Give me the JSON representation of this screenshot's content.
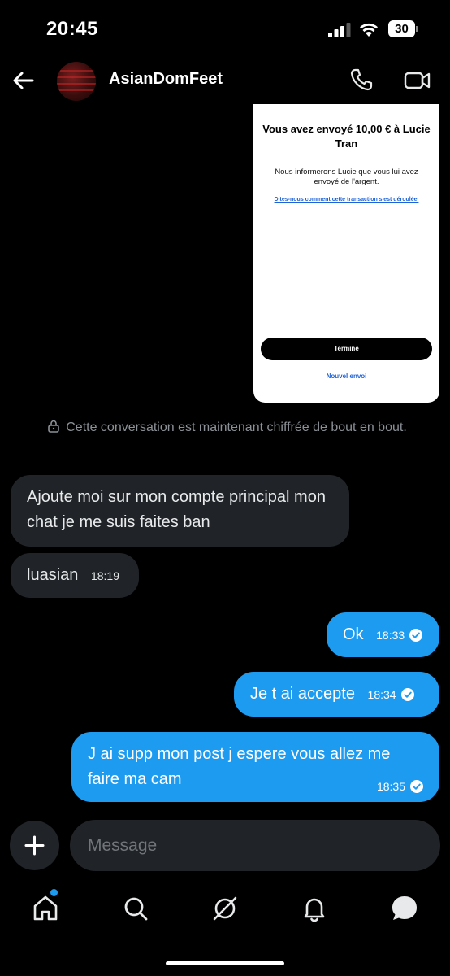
{
  "status_bar": {
    "time": "20:45",
    "battery": "30"
  },
  "header": {
    "contact_name": "AsianDomFeet"
  },
  "shared_image": {
    "title": "Vous avez envoyé 10,00 € à Lucie Tran",
    "description": "Nous informerons Lucie que vous lui avez envoyé de l'argent.",
    "feedback_link": "Dites-nous comment cette transaction s'est déroulée.",
    "done_button": "Terminé",
    "new_send_link": "Nouvel envoi"
  },
  "encryption_notice": "Cette conversation est maintenant chiffrée de bout en bout.",
  "messages": [
    {
      "direction": "in",
      "text": "Ajoute moi sur mon compte principal mon chat je me suis faites ban",
      "time": ""
    },
    {
      "direction": "in",
      "text": "luasian",
      "time": "18:19"
    },
    {
      "direction": "out",
      "text": "Ok",
      "time": "18:33"
    },
    {
      "direction": "out",
      "text": "Je t ai accepte",
      "time": "18:34"
    },
    {
      "direction": "out",
      "text": "J ai supp mon post j espere vous allez me faire ma cam",
      "time": "18:35"
    }
  ],
  "composer": {
    "placeholder": "Message"
  },
  "nav": {
    "items": [
      "home-icon",
      "search-icon",
      "grok-icon",
      "notifications-icon",
      "messages-icon"
    ]
  },
  "colors": {
    "accent": "#1d9bf0",
    "incoming_bubble": "#202327",
    "background": "#000000"
  }
}
